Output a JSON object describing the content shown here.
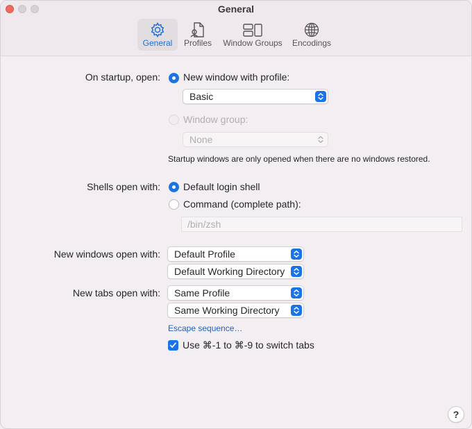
{
  "window": {
    "title": "General"
  },
  "toolbar": {
    "tabs": [
      {
        "label": "General",
        "icon": "gear-icon",
        "selected": true
      },
      {
        "label": "Profiles",
        "icon": "profile-document-icon",
        "selected": false
      },
      {
        "label": "Window Groups",
        "icon": "window-groups-icon",
        "selected": false
      },
      {
        "label": "Encodings",
        "icon": "globe-icon",
        "selected": false
      }
    ]
  },
  "startup": {
    "label": "On startup, open:",
    "option_new_window": "New window with profile:",
    "profile_select": "Basic",
    "option_window_group": "Window group:",
    "group_select": "None",
    "note": "Startup windows are only opened when there are no windows restored."
  },
  "shells": {
    "label": "Shells open with:",
    "option_default": "Default login shell",
    "option_command": "Command (complete path):",
    "command_placeholder": "/bin/zsh"
  },
  "new_windows": {
    "label": "New windows open with:",
    "profile_select": "Default Profile",
    "directory_select": "Default Working Directory"
  },
  "new_tabs": {
    "label": "New tabs open with:",
    "profile_select": "Same Profile",
    "directory_select": "Same Working Directory"
  },
  "escape_link": "Escape sequence…",
  "switch_tabs_checkbox": "Use ⌘-1 to ⌘-9 to switch tabs",
  "help": "?",
  "colors": {
    "accent": "#1a73e8",
    "link": "#1a62c9",
    "background": "#f3eef2"
  }
}
